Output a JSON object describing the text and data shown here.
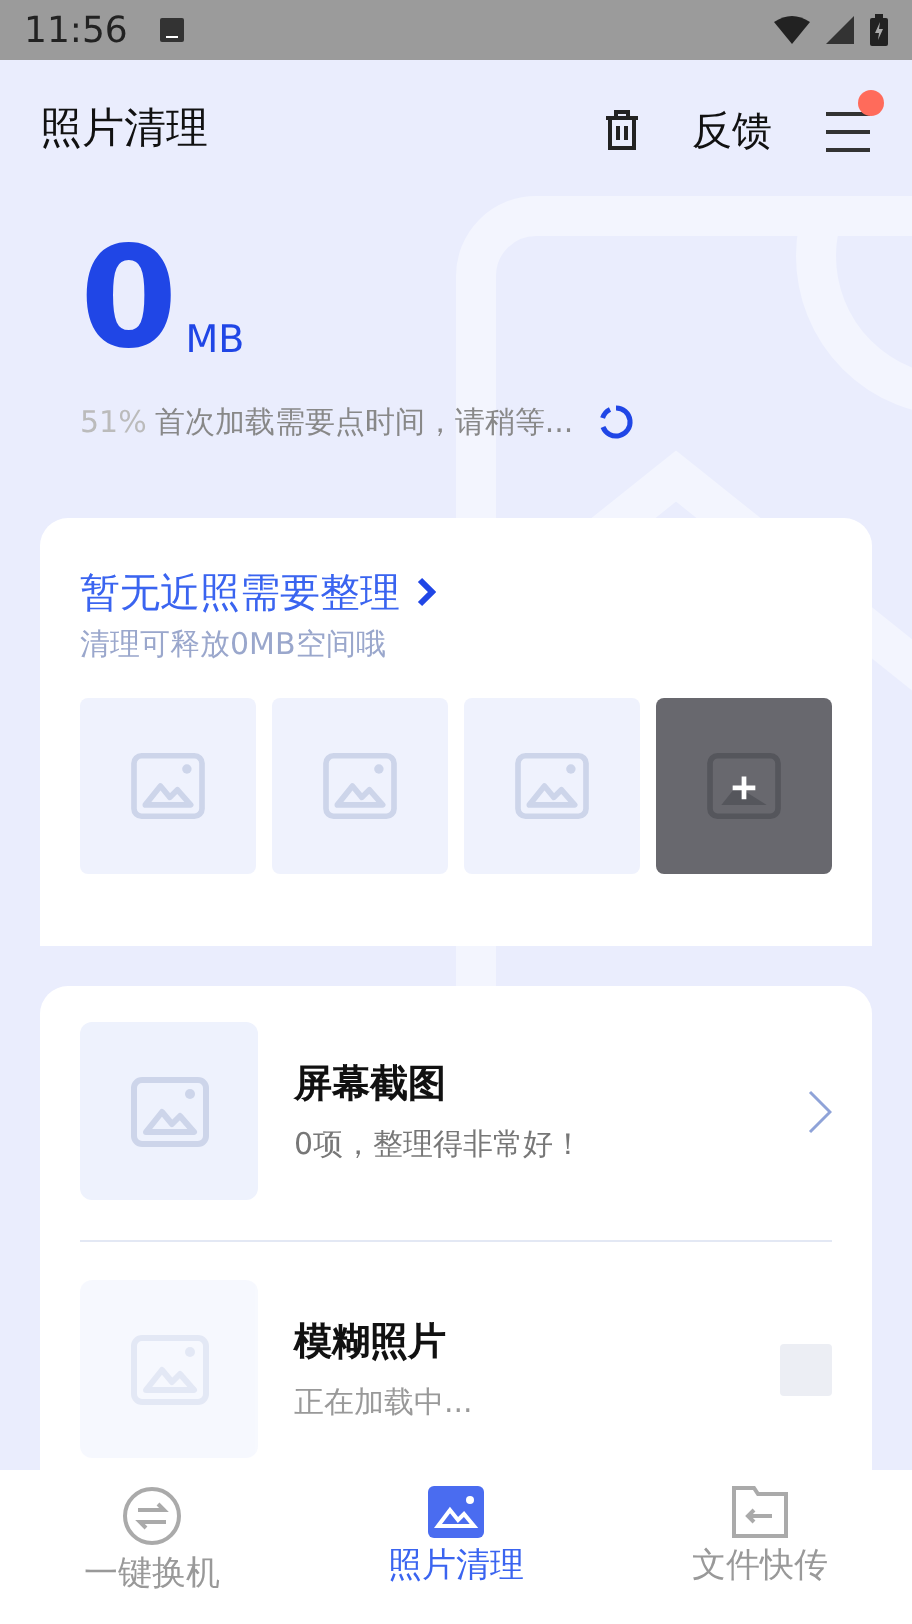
{
  "status_bar": {
    "time": "11:56"
  },
  "header": {
    "title": "照片清理",
    "feedback": "反馈",
    "menu_notification": true
  },
  "summary": {
    "size": "0",
    "unit": "MB",
    "percent": "51%",
    "loading_text": "首次加载需要点时间，请稍等..."
  },
  "recent": {
    "title": "暂无近照需要整理",
    "subtitle": "清理可释放0MB空间哦",
    "thumbnails": [
      {
        "kind": "placeholder"
      },
      {
        "kind": "placeholder"
      },
      {
        "kind": "placeholder"
      },
      {
        "kind": "add"
      }
    ]
  },
  "categories": [
    {
      "title": "屏幕截图",
      "subtitle": "0项，整理得非常好！",
      "loading": false
    },
    {
      "title": "模糊照片",
      "subtitle": "正在加载中...",
      "loading": true
    }
  ],
  "tabs": [
    {
      "kind": "switch",
      "label": "一键换机",
      "selected": false
    },
    {
      "kind": "photo",
      "label": "照片清理",
      "selected": true
    },
    {
      "kind": "transfer",
      "label": "文件快传",
      "selected": false
    }
  ]
}
